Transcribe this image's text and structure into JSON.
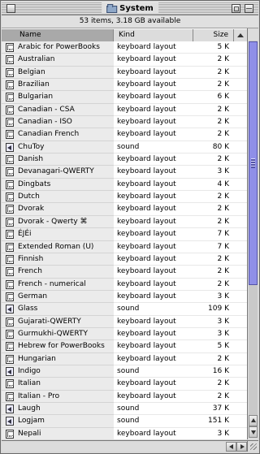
{
  "window": {
    "title": "System",
    "info": "53 items, 3.18 GB available"
  },
  "columns": {
    "name": "Name",
    "kind": "Kind",
    "size": "Size"
  },
  "items": [
    {
      "name": "Arabic for PowerBooks",
      "kind": "keyboard layout",
      "size": "5 K",
      "icon": "keyboard-layout-file-icon"
    },
    {
      "name": "Australian",
      "kind": "keyboard layout",
      "size": "2 K",
      "icon": "keyboard-layout-file-icon"
    },
    {
      "name": "Belgian",
      "kind": "keyboard layout",
      "size": "2 K",
      "icon": "keyboard-layout-file-icon"
    },
    {
      "name": "Brazilian",
      "kind": "keyboard layout",
      "size": "2 K",
      "icon": "keyboard-layout-file-icon"
    },
    {
      "name": "Bulgarian",
      "kind": "keyboard layout",
      "size": "6 K",
      "icon": "keyboard-layout-file-icon"
    },
    {
      "name": "Canadian - CSA",
      "kind": "keyboard layout",
      "size": "2 K",
      "icon": "keyboard-layout-file-icon"
    },
    {
      "name": "Canadian - ISO",
      "kind": "keyboard layout",
      "size": "2 K",
      "icon": "keyboard-layout-file-icon"
    },
    {
      "name": "Canadian French",
      "kind": "keyboard layout",
      "size": "2 K",
      "icon": "keyboard-layout-file-icon"
    },
    {
      "name": "ChuToy",
      "kind": "sound",
      "size": "80 K",
      "icon": "sound-file-icon"
    },
    {
      "name": "Danish",
      "kind": "keyboard layout",
      "size": "2 K",
      "icon": "keyboard-layout-file-icon"
    },
    {
      "name": "Devanagari-QWERTY",
      "kind": "keyboard layout",
      "size": "3 K",
      "icon": "keyboard-layout-file-icon"
    },
    {
      "name": "Dingbats",
      "kind": "keyboard layout",
      "size": "4 K",
      "icon": "keyboard-layout-file-icon"
    },
    {
      "name": "Dutch",
      "kind": "keyboard layout",
      "size": "2 K",
      "icon": "keyboard-layout-file-icon"
    },
    {
      "name": "Dvorak",
      "kind": "keyboard layout",
      "size": "2 K",
      "icon": "keyboard-layout-file-icon"
    },
    {
      "name": "Dvorak - Qwerty ⌘",
      "kind": "keyboard layout",
      "size": "2 K",
      "icon": "keyboard-layout-file-icon"
    },
    {
      "name": "ÉJÉi",
      "kind": "keyboard layout",
      "size": "7 K",
      "icon": "keyboard-layout-file-icon"
    },
    {
      "name": "Extended Roman (U)",
      "kind": "keyboard layout",
      "size": "7 K",
      "icon": "keyboard-layout-file-icon"
    },
    {
      "name": "Finnish",
      "kind": "keyboard layout",
      "size": "2 K",
      "icon": "keyboard-layout-file-icon"
    },
    {
      "name": "French",
      "kind": "keyboard layout",
      "size": "2 K",
      "icon": "keyboard-layout-file-icon"
    },
    {
      "name": "French - numerical",
      "kind": "keyboard layout",
      "size": "2 K",
      "icon": "keyboard-layout-file-icon"
    },
    {
      "name": "German",
      "kind": "keyboard layout",
      "size": "3 K",
      "icon": "keyboard-layout-file-icon"
    },
    {
      "name": "Glass",
      "kind": "sound",
      "size": "109 K",
      "icon": "sound-file-icon"
    },
    {
      "name": "Gujarati-QWERTY",
      "kind": "keyboard layout",
      "size": "3 K",
      "icon": "keyboard-layout-file-icon"
    },
    {
      "name": "Gurmukhi-QWERTY",
      "kind": "keyboard layout",
      "size": "3 K",
      "icon": "keyboard-layout-file-icon"
    },
    {
      "name": "Hebrew for PowerBooks",
      "kind": "keyboard layout",
      "size": "5 K",
      "icon": "keyboard-layout-file-icon"
    },
    {
      "name": "Hungarian",
      "kind": "keyboard layout",
      "size": "2 K",
      "icon": "keyboard-layout-file-icon"
    },
    {
      "name": "Indigo",
      "kind": "sound",
      "size": "16 K",
      "icon": "sound-file-icon"
    },
    {
      "name": "Italian",
      "kind": "keyboard layout",
      "size": "2 K",
      "icon": "keyboard-layout-file-icon"
    },
    {
      "name": "Italian - Pro",
      "kind": "keyboard layout",
      "size": "2 K",
      "icon": "keyboard-layout-file-icon"
    },
    {
      "name": "Laugh",
      "kind": "sound",
      "size": "37 K",
      "icon": "sound-file-icon"
    },
    {
      "name": "Logjam",
      "kind": "sound",
      "size": "151 K",
      "icon": "sound-file-icon"
    },
    {
      "name": "Nepali",
      "kind": "keyboard layout",
      "size": "3 K",
      "icon": "keyboard-layout-file-icon"
    }
  ]
}
